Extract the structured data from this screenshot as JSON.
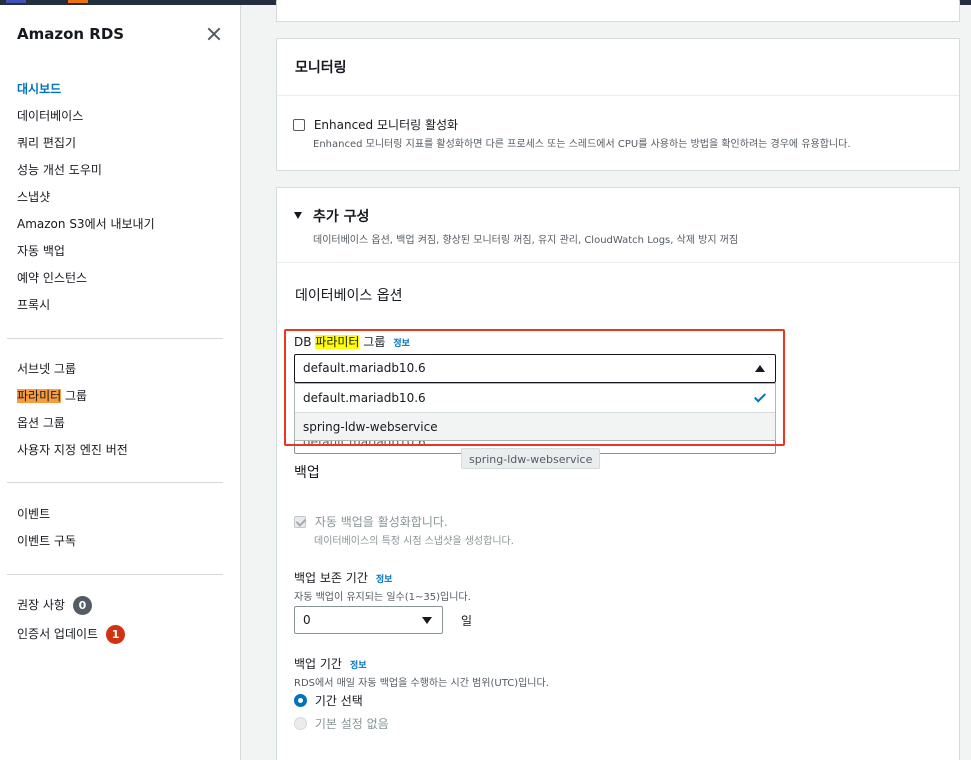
{
  "sidebar": {
    "title": "Amazon RDS",
    "group1": [
      {
        "label": "대시보드",
        "active": true
      },
      {
        "label": "데이터베이스"
      },
      {
        "label": "쿼리 편집기"
      },
      {
        "label": "성능 개선 도우미"
      },
      {
        "label": "스냅샷"
      },
      {
        "label": "Amazon S3에서 내보내기"
      },
      {
        "label": "자동 백업"
      },
      {
        "label": "예약 인스턴스"
      },
      {
        "label": "프록시"
      }
    ],
    "group2": {
      "subnet": "서브넷 그룹",
      "param_highlight": "파라미터",
      "param_rest": " 그룹",
      "option": "옵션 그룹",
      "custom_engine": "사용자 지정 엔진 버전"
    },
    "group3": [
      "이벤트",
      "이벤트 구독"
    ],
    "group4": {
      "recommend": "권장 사항",
      "recommend_count": "0",
      "cert": "인증서 업데이트",
      "cert_count": "1"
    }
  },
  "monitoring": {
    "title": "모니터링",
    "enhanced_label": "Enhanced 모니터링 활성화",
    "enhanced_desc": "Enhanced 모니터링 지표를 활성화하면 다른 프로세스 또는 스레드에서 CPU를 사용하는 방법을 확인하려는 경우에 유용합니다."
  },
  "additional": {
    "title": "추가 구성",
    "subtitle": "데이터베이스 옵션, 백업 켜짐, 향상된 모니터링 꺼짐, 유지 관리, CloudWatch Logs, 삭제 방지 꺼짐",
    "db_options_title": "데이터베이스 옵션",
    "param_group_prefix": "DB ",
    "param_group_highlight": "파라미터",
    "param_group_suffix": " 그룹",
    "info": "정보",
    "param_selected": "default.mariadb10.6",
    "options": [
      "default.mariadb10.6",
      "spring-ldw-webservice"
    ],
    "hidden_field_value": "default.mariadb10.6",
    "tooltip": "spring-ldw-webservice"
  },
  "backup": {
    "title": "백업",
    "auto_label": "자동 백업을 활성화합니다.",
    "auto_desc": "데이터베이스의 특정 시점 스냅샷을 생성합니다.",
    "retention_label": "백업 보존 기간",
    "info": "정보",
    "retention_desc": "자동 백업이 유지되는 일수(1~35)입니다.",
    "retention_value": "0",
    "retention_unit": "일",
    "window_label": "백업 기간",
    "window_desc": "RDS에서 매일 자동 백업을 수행하는 시간 범위(UTC)입니다.",
    "window_opt1": "기간 선택",
    "window_opt2": "기본 설정 없음"
  },
  "colors": {
    "accent": "#0073bb",
    "highlight_yellow": "#ffff00",
    "highlight_orange": "#f89c3c",
    "annotation_red": "#e8371f"
  }
}
